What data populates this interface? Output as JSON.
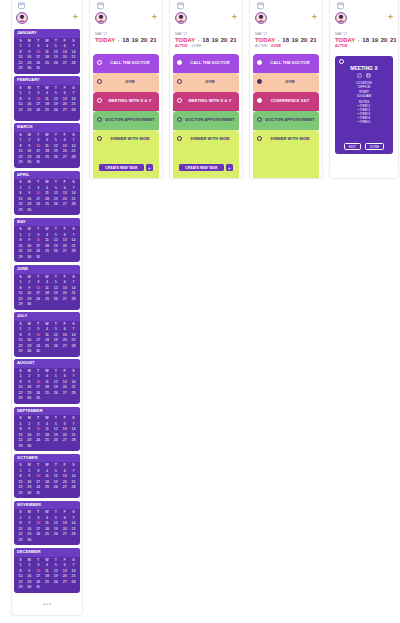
{
  "calendar": {
    "add_icon": "+",
    "weekdays": [
      "S",
      "M",
      "T",
      "W",
      "T",
      "F",
      "S"
    ],
    "months": [
      {
        "name": "JANUARY",
        "marked_day": "10",
        "days": [
          "1",
          "2",
          "3",
          "4",
          "5",
          "6",
          "7",
          "8",
          "9",
          "10",
          "11",
          "12",
          "13",
          "14",
          "15",
          "16",
          "17",
          "18",
          "19",
          "20",
          "21",
          "22",
          "23",
          "24",
          "25",
          "26",
          "27",
          "28",
          "29",
          "30",
          "31"
        ]
      },
      {
        "name": "FEBRUARY",
        "marked_day": "10",
        "days": [
          "1",
          "2",
          "3",
          "4",
          "5",
          "6",
          "7",
          "8",
          "9",
          "10",
          "11",
          "12",
          "13",
          "14",
          "15",
          "16",
          "17",
          "18",
          "19",
          "20",
          "21",
          "22",
          "23",
          "24",
          "25",
          "26",
          "27",
          "28"
        ]
      },
      {
        "name": "MARCH",
        "marked_day": "10",
        "days": [
          "1",
          "2",
          "3",
          "4",
          "5",
          "6",
          "7",
          "8",
          "9",
          "10",
          "11",
          "12",
          "13",
          "14",
          "15",
          "16",
          "17",
          "18",
          "19",
          "20",
          "21",
          "22",
          "23",
          "24",
          "25",
          "26",
          "27",
          "28",
          "29",
          "30",
          "31"
        ]
      },
      {
        "name": "APRIL",
        "marked_day": "10",
        "days": [
          "1",
          "2",
          "3",
          "4",
          "5",
          "6",
          "7",
          "8",
          "9",
          "10",
          "11",
          "12",
          "13",
          "14",
          "15",
          "16",
          "17",
          "18",
          "19",
          "20",
          "21",
          "22",
          "23",
          "24",
          "25",
          "26",
          "27",
          "28",
          "29",
          "30"
        ]
      },
      {
        "name": "MAY",
        "marked_day": "10",
        "days": [
          "1",
          "2",
          "3",
          "4",
          "5",
          "6",
          "7",
          "8",
          "9",
          "10",
          "11",
          "12",
          "13",
          "14",
          "15",
          "16",
          "17",
          "18",
          "19",
          "20",
          "21",
          "22",
          "23",
          "24",
          "25",
          "26",
          "27",
          "28",
          "29",
          "30",
          "31"
        ]
      },
      {
        "name": "JUNE",
        "marked_day": "10",
        "days": [
          "1",
          "2",
          "3",
          "4",
          "5",
          "6",
          "7",
          "8",
          "9",
          "10",
          "11",
          "12",
          "13",
          "14",
          "15",
          "16",
          "17",
          "18",
          "19",
          "20",
          "21",
          "22",
          "23",
          "24",
          "25",
          "26",
          "27",
          "28",
          "29",
          "30"
        ]
      },
      {
        "name": "JULY",
        "marked_day": "10",
        "days": [
          "1",
          "2",
          "3",
          "4",
          "5",
          "6",
          "7",
          "8",
          "9",
          "10",
          "11",
          "12",
          "13",
          "14",
          "15",
          "16",
          "17",
          "18",
          "19",
          "20",
          "21",
          "22",
          "23",
          "24",
          "25",
          "26",
          "27",
          "28",
          "29",
          "30",
          "31"
        ]
      },
      {
        "name": "AUGUST",
        "marked_day": "10",
        "days": [
          "1",
          "2",
          "3",
          "4",
          "5",
          "6",
          "7",
          "8",
          "9",
          "10",
          "11",
          "12",
          "13",
          "14",
          "15",
          "16",
          "17",
          "18",
          "19",
          "20",
          "21",
          "22",
          "23",
          "24",
          "25",
          "26",
          "27",
          "28",
          "29",
          "30",
          "31"
        ]
      },
      {
        "name": "SEPTEMBER",
        "marked_day": "10",
        "days": [
          "1",
          "2",
          "3",
          "4",
          "5",
          "6",
          "7",
          "8",
          "9",
          "10",
          "11",
          "12",
          "13",
          "14",
          "15",
          "16",
          "17",
          "18",
          "19",
          "20",
          "21",
          "22",
          "23",
          "24",
          "25",
          "26",
          "27",
          "28",
          "29",
          "30"
        ]
      },
      {
        "name": "OCTOBER",
        "marked_day": "10",
        "days": [
          "1",
          "2",
          "3",
          "4",
          "5",
          "6",
          "7",
          "8",
          "9",
          "10",
          "11",
          "12",
          "13",
          "14",
          "15",
          "16",
          "17",
          "18",
          "19",
          "20",
          "21",
          "22",
          "23",
          "24",
          "25",
          "26",
          "27",
          "28",
          "29",
          "30",
          "31"
        ]
      },
      {
        "name": "NOVEMBER",
        "marked_day": "10",
        "days": [
          "1",
          "2",
          "3",
          "4",
          "5",
          "6",
          "7",
          "8",
          "9",
          "10",
          "11",
          "12",
          "13",
          "14",
          "15",
          "16",
          "17",
          "18",
          "19",
          "20",
          "21",
          "22",
          "23",
          "24",
          "25",
          "26",
          "27",
          "28",
          "29",
          "30"
        ]
      },
      {
        "name": "DECEMBER",
        "marked_day": "10",
        "days": [
          "1",
          "2",
          "3",
          "4",
          "5",
          "6",
          "7",
          "8",
          "9",
          "10",
          "11",
          "12",
          "13",
          "14",
          "15",
          "16",
          "17",
          "18",
          "19",
          "20",
          "21",
          "22",
          "23",
          "24",
          "25",
          "26",
          "27",
          "28",
          "29",
          "30",
          "31"
        ]
      }
    ],
    "footer": "• • •"
  },
  "task_screens": [
    {
      "add_icon": "+",
      "date_caption": "MAY 17",
      "date_separator": "·",
      "dates": [
        {
          "label": "TODAY",
          "selected": true
        },
        {
          "label": "18",
          "selected": false
        },
        {
          "label": "19",
          "selected": false
        },
        {
          "label": "20",
          "selected": false
        },
        {
          "label": "21",
          "selected": false
        }
      ],
      "tabs": [],
      "tasks": [
        {
          "title": "CALL THE DOCTOR",
          "color": "#a44be3",
          "checked": false
        },
        {
          "title": "GYM",
          "color": "#f9c8a8",
          "checked": false
        },
        {
          "title": "MEETING WITH X & Y",
          "color": "#c93b7f",
          "checked": false
        },
        {
          "title": "DOCTOR APPOINTMENT",
          "color": "#7cc878",
          "checked": false
        },
        {
          "title": "DINNER WITH MOM",
          "color": "#d9ee6b",
          "checked": false
        }
      ],
      "create_button": {
        "label": "CREATE NEW TASK",
        "icon": "+"
      }
    },
    {
      "add_icon": "+",
      "date_caption": "MAY 17",
      "date_separator": "·",
      "dates": [
        {
          "label": "TODAY",
          "selected": true
        },
        {
          "label": "18",
          "selected": false
        },
        {
          "label": "19",
          "selected": false
        },
        {
          "label": "20",
          "selected": false
        },
        {
          "label": "21",
          "selected": false
        }
      ],
      "tabs": [
        {
          "label": "ACTIVE",
          "selected": true
        },
        {
          "label": "DONE",
          "selected": false
        }
      ],
      "tasks": [
        {
          "title": "CALL THE DOCTOR",
          "color": "#a44be3",
          "checked": true
        },
        {
          "title": "GYM",
          "color": "#f9c8a8",
          "checked": false
        },
        {
          "title": "MEETING WITH X & Y",
          "color": "#c93b7f",
          "checked": false
        },
        {
          "title": "DOCTOR APPOINTMENT",
          "color": "#7cc878",
          "checked": false
        },
        {
          "title": "DINNER WITH MOM",
          "color": "#d9ee6b",
          "checked": false
        }
      ],
      "create_button": {
        "label": "CREATE NEW TASK",
        "icon": "+"
      }
    },
    {
      "add_icon": "+",
      "date_caption": "MAY 17",
      "date_separator": "·",
      "dates": [
        {
          "label": "TODAY",
          "selected": true
        },
        {
          "label": "18",
          "selected": false
        },
        {
          "label": "19",
          "selected": false
        },
        {
          "label": "20",
          "selected": false
        },
        {
          "label": "21",
          "selected": false
        }
      ],
      "tabs": [
        {
          "label": "ACTIVE",
          "selected": false
        },
        {
          "label": "DONE",
          "selected": true
        }
      ],
      "tasks": [
        {
          "title": "CALL THE DOCTOR",
          "color": "#a44be3",
          "checked": true
        },
        {
          "title": "GYM",
          "color": "#f9c8a8",
          "checked": true
        },
        {
          "title": "CONFERENCE X&Y",
          "color": "#c93b7f",
          "checked": true
        },
        {
          "title": "DOCTOR APPOINTMENT",
          "color": "#7cc878",
          "checked": false
        },
        {
          "title": "DINNER WITH MOM",
          "color": "#d9ee6b",
          "checked": false
        }
      ]
    }
  ],
  "detail_screen": {
    "add_icon": "+",
    "date_caption": "MAY 17",
    "date_separator": "·",
    "dates": [
      {
        "label": "TODAY",
        "selected": true
      },
      {
        "label": "18",
        "selected": false
      },
      {
        "label": "19",
        "selected": false
      },
      {
        "label": "20",
        "selected": false
      },
      {
        "label": "21",
        "selected": false
      }
    ],
    "tabs": [
      {
        "label": "ACTIVE",
        "selected": true
      }
    ],
    "meeting": {
      "checked": false,
      "title": "MEETING X",
      "fields": [
        {
          "label": "LOCATION",
          "value": "OFFICE"
        },
        {
          "label": "START",
          "value": "10:00 AM"
        }
      ],
      "notes_label": "NOTES",
      "notes": [
        "• ITEM 1",
        "• ITEM 2",
        "• ITEM 3",
        "• ITEM 4",
        "• ITEM 5"
      ],
      "actions": [
        "EDIT",
        "DONE"
      ]
    }
  }
}
